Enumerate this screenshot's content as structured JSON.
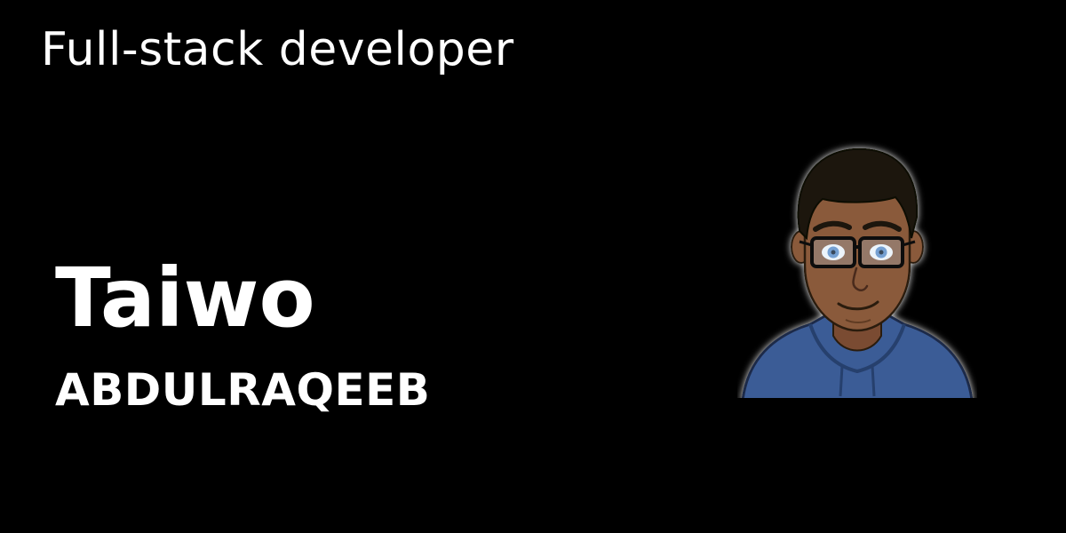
{
  "banner": {
    "role": "Full-stack developer",
    "first_name": "Taiwo",
    "last_name": "ABDULRAQEEB",
    "avatar_icon": "developer-avatar-illustration"
  },
  "colors": {
    "background": "#000000",
    "text": "#ffffff",
    "hoodie": "#3b5b96",
    "skin": "#8a5a3b",
    "hair": "#1a1410"
  }
}
